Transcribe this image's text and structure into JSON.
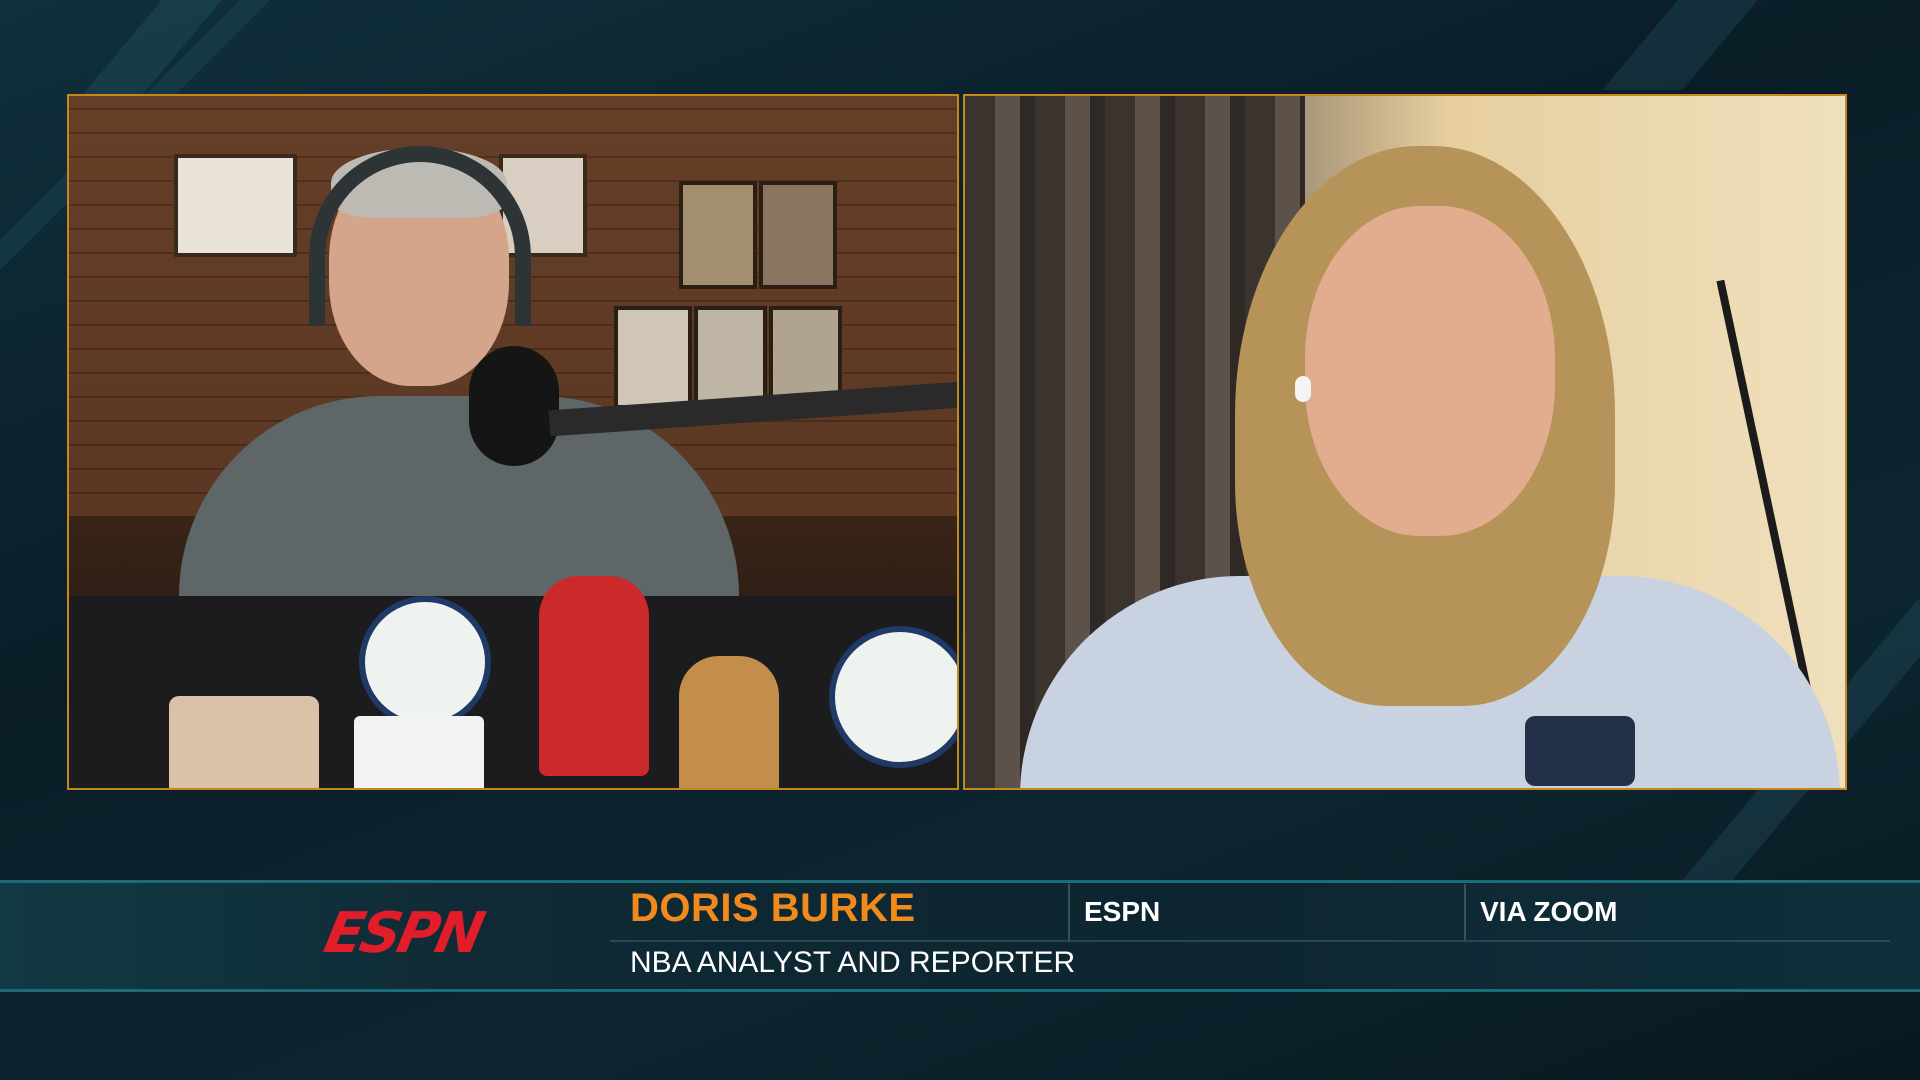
{
  "broadcast": {
    "network_logo": "ESPN",
    "guest_name": "DORIS BURKE",
    "guest_title": "NBA ANALYST AND REPORTER",
    "affiliation": "ESPN",
    "connection": "VIA ZOOM"
  },
  "colors": {
    "frame_border": "#c8871e",
    "name_orange": "#f08a1c",
    "espn_red": "#e21d2a",
    "bar_teal": "#1d6d78"
  }
}
